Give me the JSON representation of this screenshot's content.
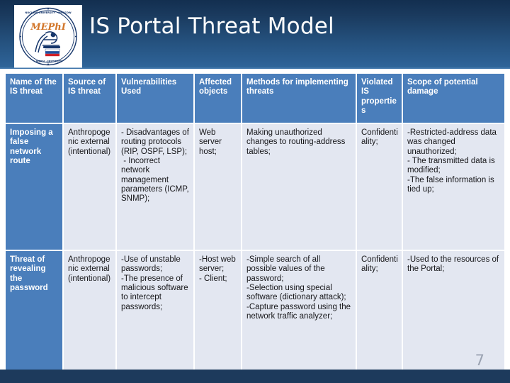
{
  "slide": {
    "title": "IS Portal Threat Model",
    "page_number": "7",
    "logo": {
      "name": "mephi-seal-logo",
      "wordmark": "MEPhI",
      "ring_text_top": "NUCLEAR UNIVERSITY · MOSCOW ENGINEERING PHYSICS",
      "ring_text_bottom": "INSTITUTE · MEPhI · NATIONAL RESEARCH"
    },
    "colors": {
      "banner_top": "#132f50",
      "banner_bottom": "#30679b",
      "header_cell": "#4a7ebb",
      "body_cell": "#e3e7f1",
      "bottom_bar": "#1d3a5c",
      "page_number": "#9aa2b1"
    }
  },
  "table": {
    "columns": [
      "Name of the IS threat",
      "Source of IS threat",
      "Vulnerabilities Used",
      "Affected objects",
      "Methods for implementing threats",
      "Violated IS properties",
      "Scope of potential damage"
    ],
    "rows": [
      {
        "name": "Imposing a false network route",
        "source": "Anthropogenic external (intentional)",
        "vulnerabilities": "- Disadvantages of routing protocols (RIP, OSPF, LSP);\n - Incorrect network management parameters (ICMP, SNMP);",
        "affected_objects": "Web server host;",
        "methods": "Making unauthorized changes to routing-address tables;",
        "violated_properties": "Confidentiality;",
        "damage": "-Restricted-address data was changed unauthorized;\n- The transmitted data is modified;\n-The false information is tied up;"
      },
      {
        "name": "Threat of revealing the password",
        "source": "Anthropogenic external (intentional)",
        "vulnerabilities": "-Use of unstable passwords;\n-The presence of malicious software to intercept passwords;",
        "affected_objects": "-Host web server;\n- Client;",
        "methods": "-Simple search of all possible values of the password;\n-Selection using special software (dictionary attack);\n-Capture password using the network traffic analyzer;",
        "violated_properties": "Confidentiality;",
        "damage": "-Used to the resources of the Portal;"
      }
    ]
  }
}
